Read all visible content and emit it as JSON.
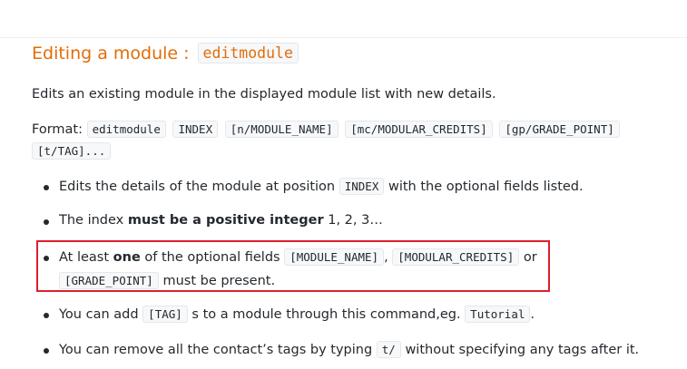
{
  "section": {
    "title": "Editing a module :",
    "command": "editmodule"
  },
  "description": "Edits an existing module in the displayed module list with new details.",
  "format": {
    "label": "Format:",
    "tokens": [
      "editmodule",
      "INDEX",
      "[n/MODULE_NAME]",
      "[mc/MODULAR_CREDITS]",
      "[gp/GRADE_POINT]",
      "[t/TAG]..."
    ]
  },
  "bullets": {
    "b1": {
      "pre": "Edits the details of the module at position",
      "code": "INDEX",
      "post": "with the optional fields listed."
    },
    "b2": {
      "pre": "The index",
      "bold": "must be a positive integer",
      "post": "1, 2, 3…"
    },
    "b3": {
      "pre": "At least",
      "bold": "one",
      "mid": "of the optional fields",
      "code1": "[MODULE_NAME]",
      "sep": ",",
      "code2": "[MODULAR_CREDITS]",
      "or": "or",
      "code3": "[GRADE_POINT]",
      "post": "must be present."
    },
    "b4": {
      "pre": "You can add",
      "code1": "[TAG]",
      "mid": "s to a module through this command,eg.",
      "code2": "Tutorial",
      "post": "."
    },
    "b5": {
      "pre": "You can remove all the contact’s tags by typing",
      "code": "t/",
      "post": "without specifying any tags after it."
    }
  },
  "colors": {
    "heading": "#e36c09",
    "highlight_border": "#dd1f2b"
  }
}
